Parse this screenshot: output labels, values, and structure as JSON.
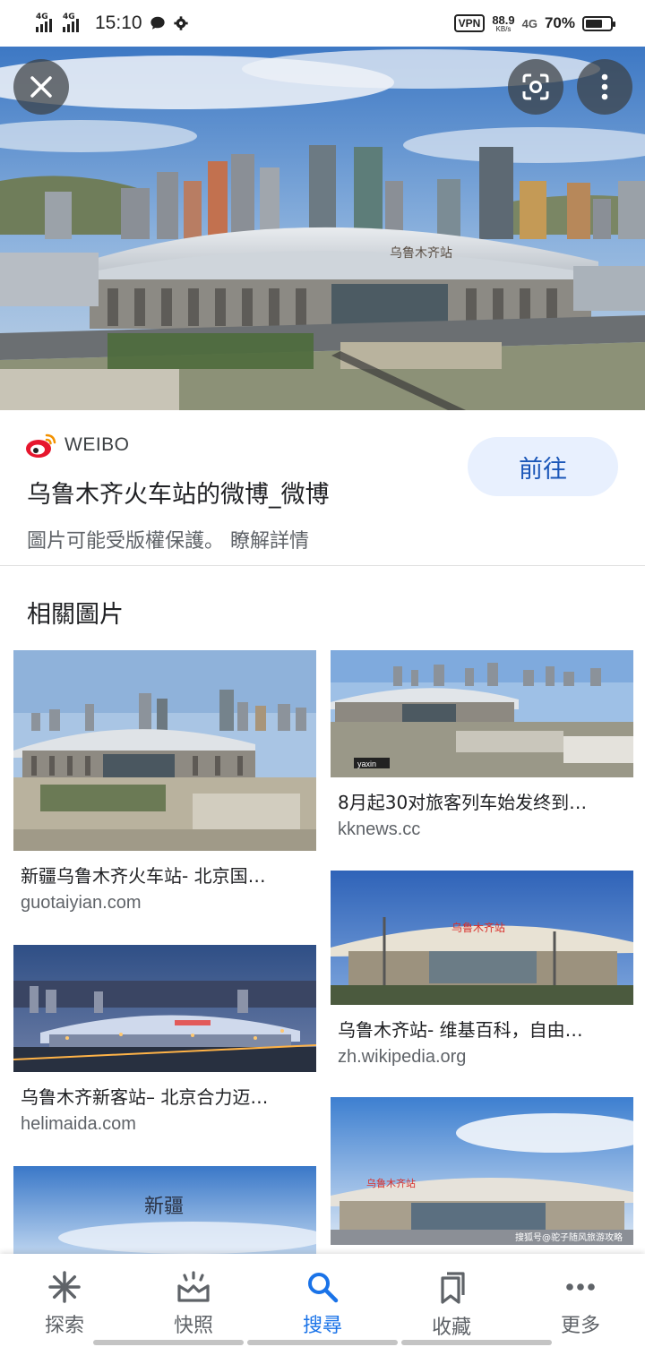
{
  "status_bar": {
    "signal1": "4G",
    "signal2": "4G",
    "time": "15:10",
    "vpn": "VPN",
    "speed_value": "88.9",
    "speed_unit": "KB/s",
    "network": "4G",
    "battery": "70%",
    "battery_level": 0.7
  },
  "hero": {
    "station_sign": "乌鲁木齐站"
  },
  "source": {
    "site_name": "WEIBO",
    "title": "乌鲁木齐火车站的微博_微博",
    "copyright": "圖片可能受版權保護。 瞭解詳情",
    "visit_label": "前往"
  },
  "related": {
    "heading": "相關圖片",
    "items": [
      {
        "title": "新疆乌鲁木齐火车站- 北京国…",
        "domain": "guotaiyian.com"
      },
      {
        "title": "8月起30对旅客列车始发终到…",
        "domain": "kknews.cc"
      },
      {
        "title": "乌鲁木齐新客站– 北京合力迈…",
        "domain": "helimaida.com"
      },
      {
        "title": "乌鲁木齐站- 维基百科，自由…",
        "domain": "zh.wikipedia.org"
      }
    ],
    "watermark_1": "yaxin",
    "watermark_5": "搜狐号@驼子随风旅游攻略",
    "calligraphy": "新疆"
  },
  "bottom_nav": [
    {
      "label": "探索",
      "icon": "asterisk-icon"
    },
    {
      "label": "快照",
      "icon": "snapshot-icon"
    },
    {
      "label": "搜尋",
      "icon": "search-icon",
      "active": true
    },
    {
      "label": "收藏",
      "icon": "bookmarks-icon"
    },
    {
      "label": "更多",
      "icon": "more-horiz-icon"
    }
  ],
  "colors": {
    "accent": "#1a73e8",
    "visit_button_bg": "#e8f0fe",
    "weibo_red": "#e6162d"
  }
}
